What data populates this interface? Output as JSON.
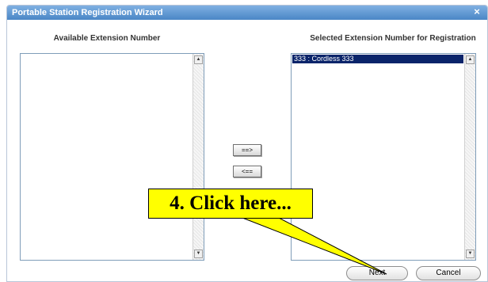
{
  "dialog": {
    "title": "Portable Station Registration Wizard",
    "close_glyph": "×"
  },
  "left_panel": {
    "header": "Available Extension Number",
    "items": []
  },
  "right_panel": {
    "header": "Selected Extension Number for Registration",
    "items": [
      {
        "label": "333 : Cordless 333",
        "selected": true
      }
    ]
  },
  "transfer": {
    "add_label": "==>",
    "remove_label": "<=="
  },
  "footer": {
    "next_label": "Next",
    "cancel_label": "Cancel"
  },
  "annotation": {
    "text": "4. Click here...",
    "color": "#ffff00"
  },
  "colors": {
    "titlebar": "#4a86c6",
    "selection": "#0a246a"
  },
  "icons": {
    "close": "close-icon",
    "scroll_up": "scroll-up-arrow-icon",
    "scroll_down": "scroll-down-arrow-icon"
  }
}
